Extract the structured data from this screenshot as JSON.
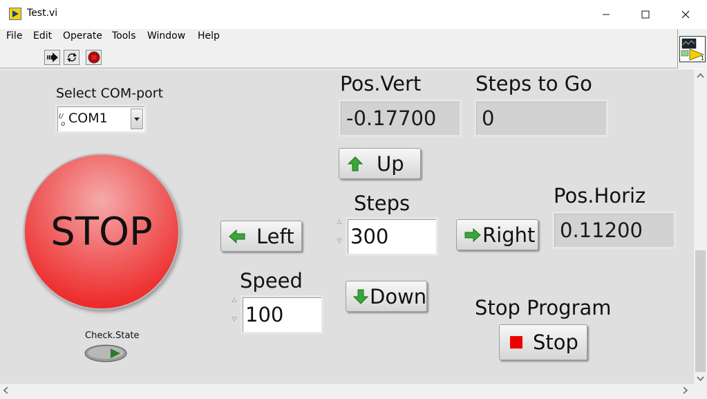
{
  "window": {
    "title": "Test.vi"
  },
  "menu": {
    "items": [
      "File",
      "Edit",
      "Operate",
      "Tools",
      "Window",
      "Help"
    ]
  },
  "toolbar": {
    "run_icon": "run-arrow-icon",
    "continuous_run_icon": "run-continuously-icon",
    "abort_icon": "abort-execution-icon"
  },
  "panel": {
    "com_port": {
      "label": "Select COM-port",
      "value": "COM1",
      "prefix": "I/O"
    },
    "stop_big": {
      "label": "STOP",
      "color": "#ee2a2a"
    },
    "check_state": {
      "label": "Check.State"
    },
    "pos_vert": {
      "label": "Pos.Vert",
      "value": "-0.17700"
    },
    "steps_to_go": {
      "label": "Steps to Go",
      "value": "0"
    },
    "up_button": {
      "label": "Up"
    },
    "steps": {
      "label": "Steps",
      "value": "300"
    },
    "left_button": {
      "label": "Left"
    },
    "right_button": {
      "label": "Right"
    },
    "pos_horiz": {
      "label": "Pos.Horiz",
      "value": "0.11200"
    },
    "speed": {
      "label": "Speed",
      "value": "100"
    },
    "down_button": {
      "label": "Down"
    },
    "stop_program": {
      "label": "Stop Program",
      "button_label": "Stop",
      "stop_color": "#ee0000"
    },
    "arrow_color": "#3aa53a"
  }
}
